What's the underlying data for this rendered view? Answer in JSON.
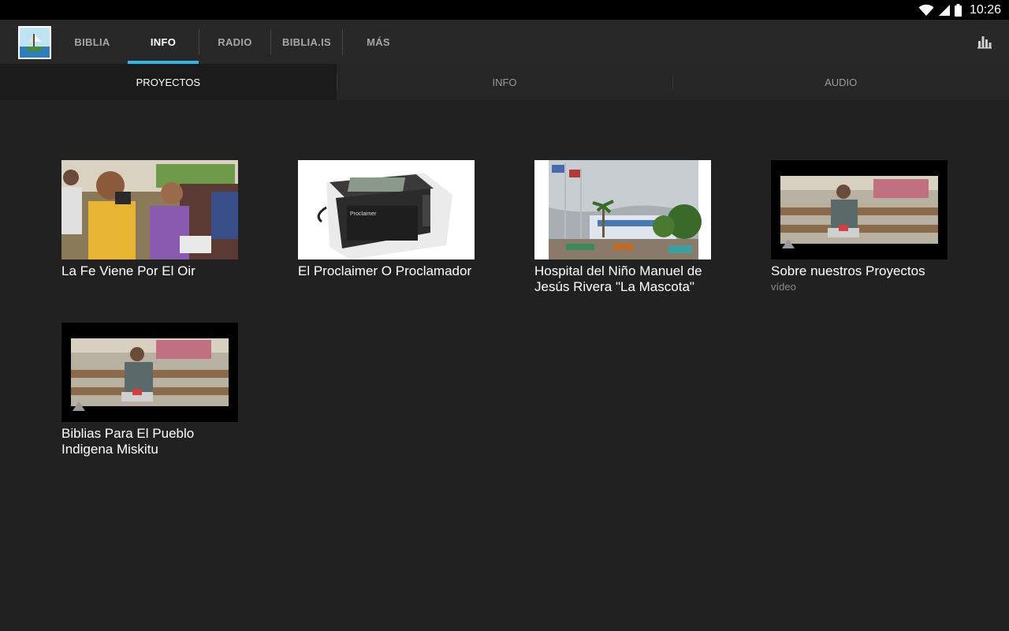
{
  "status": {
    "time": "10:26"
  },
  "actionbar": {
    "tabs": [
      {
        "label": "BIBLIA"
      },
      {
        "label": "INFO"
      },
      {
        "label": "RADIO"
      },
      {
        "label": "BIBLIA.IS"
      },
      {
        "label": "MÁS"
      }
    ],
    "active_tab": "INFO"
  },
  "subtabs": [
    {
      "label": "PROYECTOS"
    },
    {
      "label": "INFO"
    },
    {
      "label": "AUDIO"
    }
  ],
  "items": [
    {
      "title": "La Fe Viene Por El Oir",
      "subtitle": "",
      "thumb": "photo-classroom"
    },
    {
      "title": "El Proclaimer O Proclamador",
      "subtitle": "",
      "thumb": "photo-proclaimer-device",
      "device_label": "Proclaimer"
    },
    {
      "title": "Hospital del Niño Manuel de Jesús Rivera \"La Mascota\"",
      "subtitle": "",
      "thumb": "photo-hospital"
    },
    {
      "title": "Sobre nuestros Proyectos",
      "subtitle": "vídeo",
      "thumb": "video-man-reading"
    },
    {
      "title": "Biblias Para El Pueblo Indigena Miskitu",
      "subtitle": "",
      "thumb": "video-man-reading"
    }
  ],
  "colors": {
    "accent": "#33b5e5",
    "background": "#212121"
  }
}
